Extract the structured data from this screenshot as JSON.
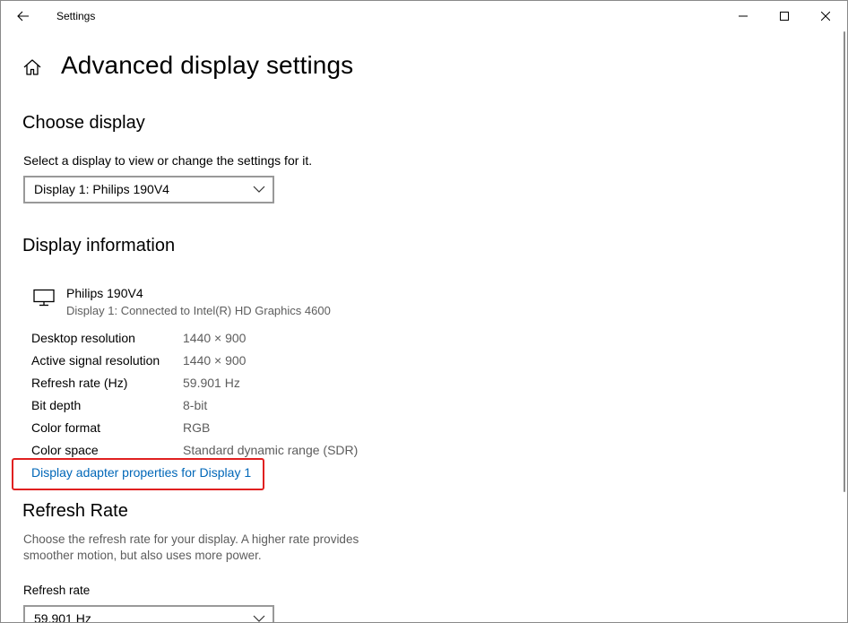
{
  "window": {
    "title": "Settings"
  },
  "page": {
    "title": "Advanced display settings"
  },
  "choose_display": {
    "heading": "Choose display",
    "description": "Select a display to view or change the settings for it.",
    "selected_display": "Display 1: Philips 190V4"
  },
  "display_information": {
    "heading": "Display information",
    "monitor_name": "Philips 190V4",
    "monitor_connection": "Display 1: Connected to Intel(R) HD Graphics 4600",
    "rows": [
      {
        "label": "Desktop resolution",
        "value": "1440 × 900"
      },
      {
        "label": "Active signal resolution",
        "value": "1440 × 900"
      },
      {
        "label": "Refresh rate (Hz)",
        "value": "59.901 Hz"
      },
      {
        "label": "Bit depth",
        "value": "8-bit"
      },
      {
        "label": "Color format",
        "value": "RGB"
      },
      {
        "label": "Color space",
        "value": "Standard dynamic range (SDR)"
      }
    ],
    "adapter_link": "Display adapter properties for Display 1"
  },
  "refresh_rate": {
    "heading": "Refresh Rate",
    "description_line1": "Choose the refresh rate for your display. A higher rate provides",
    "description_line2": "smoother motion, but also uses more power.",
    "field_label": "Refresh rate",
    "selected_rate": "59.901 Hz"
  },
  "colors": {
    "link": "#0067b8",
    "highlight": "#e02020",
    "muted_text": "#5d5d5d"
  },
  "icons": {
    "back": "back-arrow-icon",
    "minimize": "minimize-icon",
    "maximize": "maximize-icon",
    "close": "close-icon",
    "home": "home-icon",
    "monitor": "monitor-icon",
    "chevron": "chevron-down-icon"
  }
}
